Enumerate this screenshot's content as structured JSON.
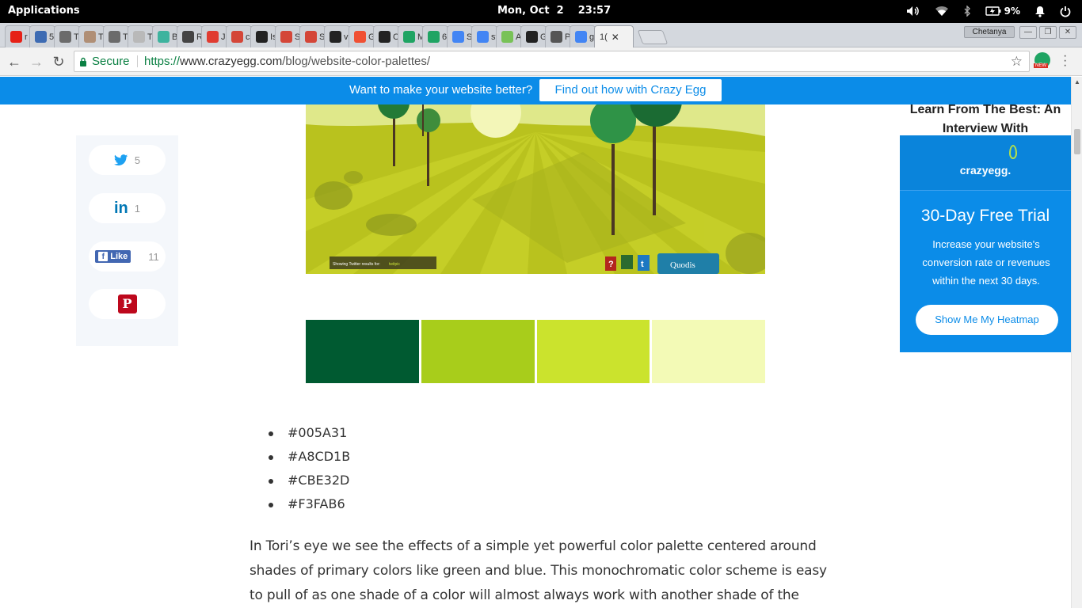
{
  "os": {
    "menu": "Applications",
    "clock": "Mon, Oct  2    23:57",
    "battery": "9%"
  },
  "browser": {
    "tabs": [
      {
        "icon": "youtube-icon",
        "label": "r",
        "color": "#e62117"
      },
      {
        "icon": "fx-icon",
        "label": "5",
        "color": "#3d6bb3"
      },
      {
        "icon": "b-icon",
        "label": "T",
        "color": "#6b6b6b"
      },
      {
        "icon": "p-icon",
        "label": "T",
        "color": "#b08f76"
      },
      {
        "icon": "b-icon",
        "label": "T",
        "color": "#6b6b6b"
      },
      {
        "icon": "k-icon",
        "label": "T",
        "color": "#b9b9b9"
      },
      {
        "icon": "w-icon",
        "label": "B",
        "color": "#3db39e"
      },
      {
        "icon": "f-icon",
        "label": "R",
        "color": "#444444"
      },
      {
        "icon": "record-icon",
        "label": "Ja",
        "color": "#e03c31"
      },
      {
        "icon": "gmail-icon",
        "label": "cl",
        "color": "#d44638"
      },
      {
        "icon": "github-icon",
        "label": "Is",
        "color": "#222222"
      },
      {
        "icon": "gmail-icon",
        "label": "S",
        "color": "#d44638"
      },
      {
        "icon": "gmail-icon",
        "label": "S",
        "color": "#d44638"
      },
      {
        "icon": "github-icon",
        "label": "vi",
        "color": "#222222"
      },
      {
        "icon": "git-icon",
        "label": "G",
        "color": "#f05033"
      },
      {
        "icon": "github-icon",
        "label": "C",
        "color": "#222222"
      },
      {
        "icon": "drive-icon",
        "label": "M",
        "color": "#1fa463"
      },
      {
        "icon": "drive-icon",
        "label": "6",
        "color": "#1fa463"
      },
      {
        "icon": "docs-icon",
        "label": "S",
        "color": "#4285f4"
      },
      {
        "icon": "docs-icon",
        "label": "st",
        "color": "#4285f4"
      },
      {
        "icon": "android-icon",
        "label": "A",
        "color": "#78c257"
      },
      {
        "icon": "github-icon",
        "label": "G",
        "color": "#222222"
      },
      {
        "icon": "wikipedia-icon",
        "label": "P",
        "color": "#555555"
      },
      {
        "icon": "google-icon",
        "label": "g",
        "color": "#4285f4"
      }
    ],
    "active_tab_label": "1(",
    "profile": "Chetanya",
    "secure_label": "Secure",
    "url_scheme": "https://",
    "url_host": "www.crazyegg.com",
    "url_path": "/blog/website-color-palettes/"
  },
  "promo": {
    "text": "Want to make your website better?",
    "button": "Find out how with Crazy Egg"
  },
  "share": {
    "twitter_count": "5",
    "linkedin_count": "1",
    "facebook_label": "Like",
    "facebook_count": "11"
  },
  "hero": {
    "twitter_search_label": "Showing Twitter results for:",
    "twitter_search_term": "twitpic",
    "brand": "Quodis"
  },
  "palette": {
    "colors": [
      "#005A31",
      "#A8CD1B",
      "#CBE32D",
      "#F3FAB6"
    ],
    "labels": [
      "#005A31",
      "#A8CD1B",
      "#CBE32D",
      "#F3FAB6"
    ]
  },
  "article": {
    "paragraph": "In Tori’s eye we see the effects of a simple yet powerful color palette centered around shades of primary colors like green and blue. This monochromatic color scheme is easy to pull of as one shade of a color will almost always work with another shade of the"
  },
  "sidebar": {
    "related_title": "Learn From The Best: An Interview With",
    "ad_brand": "crazyegg.",
    "ad_title": "30-Day Free Trial",
    "ad_desc": "Increase your website's conversion rate or revenues within the next 30 days.",
    "ad_button": "Show Me My Heatmap"
  }
}
